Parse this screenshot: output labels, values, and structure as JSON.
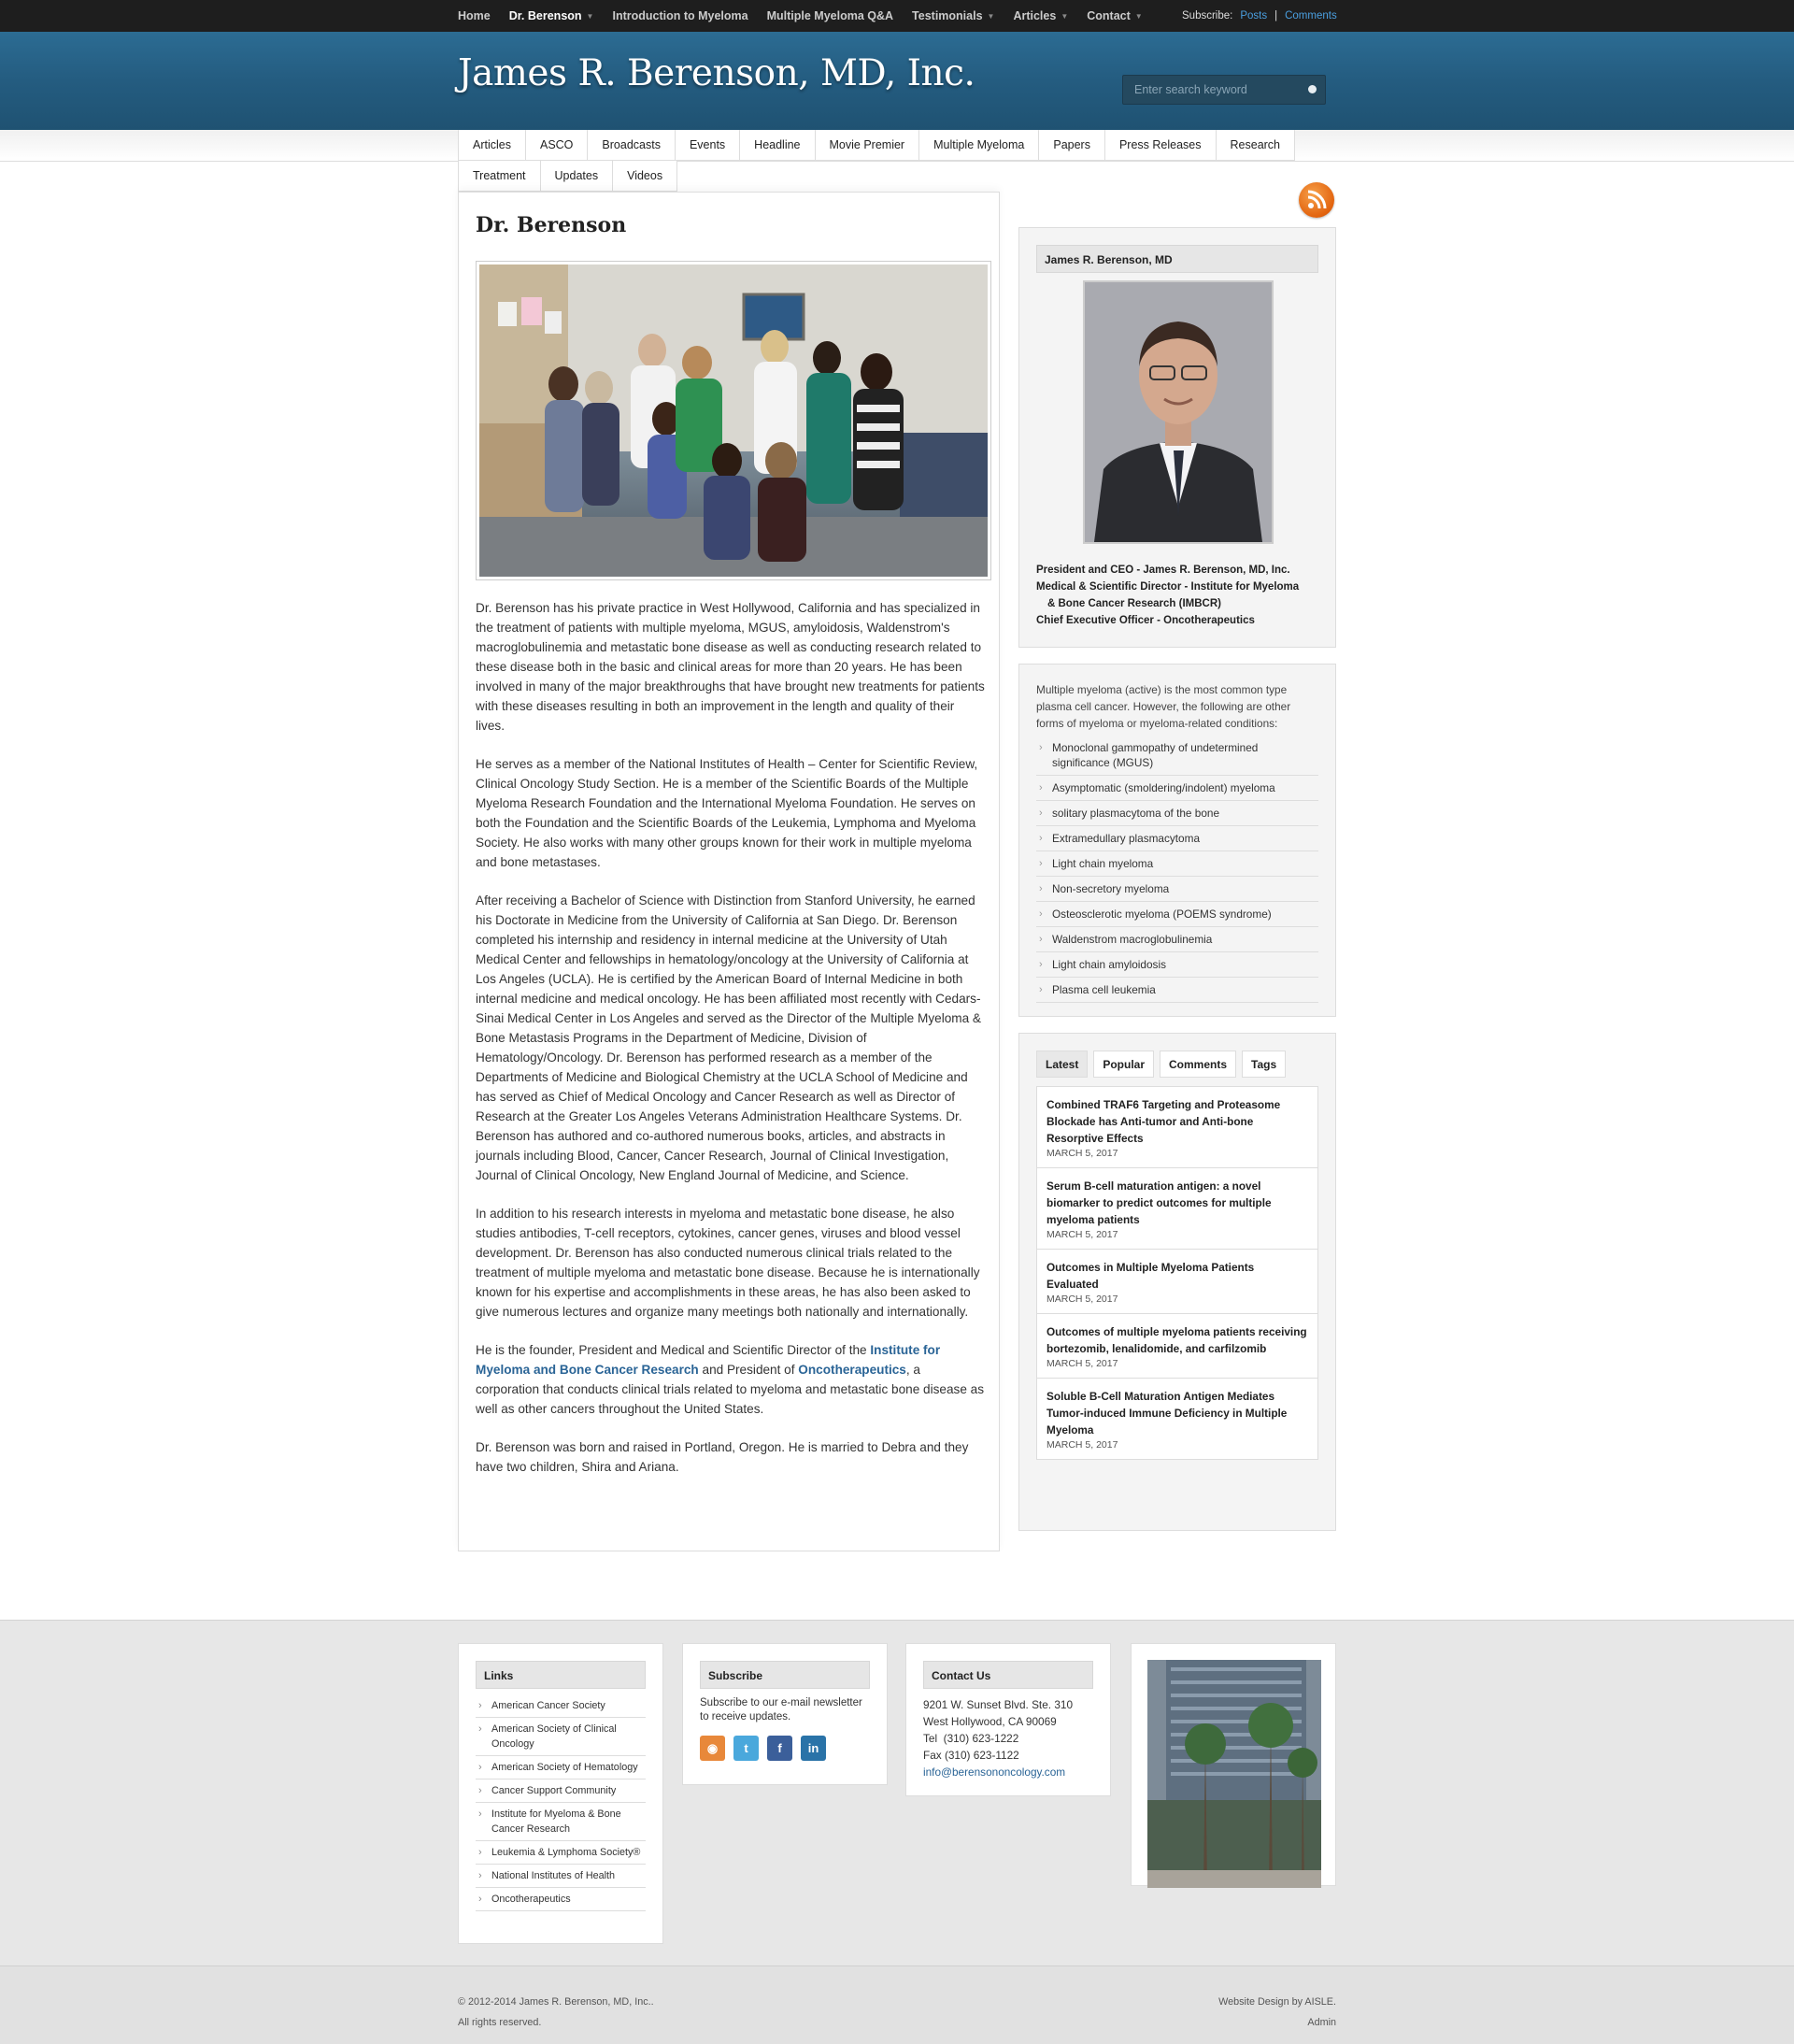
{
  "topnav": {
    "items": [
      {
        "label": "Home",
        "dropdown": false,
        "active": false
      },
      {
        "label": "Dr. Berenson",
        "dropdown": true,
        "active": true
      },
      {
        "label": "Introduction to Myeloma",
        "dropdown": false,
        "active": false
      },
      {
        "label": "Multiple Myeloma Q&A",
        "dropdown": false,
        "active": false
      },
      {
        "label": "Testimonials",
        "dropdown": true,
        "active": false
      },
      {
        "label": "Articles",
        "dropdown": true,
        "active": false
      },
      {
        "label": "Contact",
        "dropdown": true,
        "active": false
      }
    ],
    "subscribe_label": "Subscribe:",
    "posts_label": "Posts",
    "separator": "|",
    "comments_label": "Comments"
  },
  "header": {
    "title": "James R. Berenson, MD, Inc.",
    "search_placeholder": "Enter search keyword"
  },
  "catnav": {
    "items": [
      "Articles",
      "ASCO",
      "Broadcasts",
      "Events",
      "Headline",
      "Movie Premier",
      "Multiple Myeloma",
      "Papers",
      "Press Releases",
      "Research",
      "Treatment",
      "Updates",
      "Videos"
    ]
  },
  "main": {
    "title": "Dr. Berenson",
    "paragraphs": {
      "p1": "Dr. Berenson has his private practice in West Hollywood, California and has specialized in the treatment of patients with multiple myeloma, MGUS, amyloidosis, Waldenstrom's macroglobulinemia and metastatic bone disease as well as conducting research related to these disease both in the basic and clinical areas for more than 20 years. He has been involved in many of the major breakthroughs that have brought new treatments for patients with these diseases resulting in both an improvement in the length and quality of their lives.",
      "p2": "He serves as a member of the National Institutes of Health – Center for Scientific Review, Clinical Oncology Study Section. He is a member of the Scientific Boards of the Multiple Myeloma Research Foundation and the International Myeloma Foundation. He serves on both the Foundation and the Scientific Boards of the Leukemia, Lymphoma and Myeloma Society. He also works with many other groups known for their work in multiple myeloma and bone metastases.",
      "p3": "After receiving a Bachelor of Science with Distinction from Stanford University, he earned his Doctorate in Medicine from the University of California at San Diego. Dr. Berenson completed his internship and residency in internal medicine at the University of Utah Medical Center and fellowships in hematology/oncology at the University of California at Los Angeles (UCLA). He is certified by the American Board of Internal Medicine in both internal medicine and medical oncology. He has been affiliated most recently with Cedars-Sinai Medical Center in Los Angeles and served as the Director of the Multiple Myeloma & Bone Metastasis Programs in the Department of Medicine, Division of Hematology/Oncology. Dr. Berenson has performed research as a member of the Departments of Medicine and Biological Chemistry at the UCLA School of Medicine and has served as Chief of Medical Oncology and Cancer Research as well as Director of Research at the Greater Los Angeles Veterans Administration Healthcare Systems. Dr. Berenson has authored and co-authored numerous books, articles, and abstracts in journals including Blood, Cancer, Cancer Research, Journal of Clinical Investigation, Journal of Clinical Oncology, New England Journal of Medicine, and Science.",
      "p4": "In addition to his research interests in myeloma and metastatic bone disease, he also studies antibodies, T-cell receptors, cytokines, cancer genes, viruses and blood vessel development. Dr. Berenson has also conducted numerous clinical trials related to the treatment of multiple myeloma and metastatic bone disease. Because he is internationally known for his expertise and accomplishments in these areas, he has also been asked to give numerous lectures and organize many meetings both nationally and internationally.",
      "p5a": "He is the founder, President and Medical and Scientific Director of the ",
      "p5link1": "Institute for Myeloma and Bone Cancer Research",
      "p5b": " and President of ",
      "p5link2": "Oncotherapeutics",
      "p5c": ", a corporation that conducts clinical trials related to myeloma and metastatic bone disease as well as other cancers throughout the United States.",
      "p6": "Dr. Berenson was born and raised in Portland, Oregon. He is married to Debra and they have two children, Shira and Ariana."
    }
  },
  "sidebar": {
    "profile": {
      "heading": "James R. Berenson, MD",
      "roles": [
        "President and CEO - James R. Berenson, MD, Inc.",
        "Medical & Scientific Director - Institute for Myeloma",
        "& Bone Cancer Research (IMBCR)",
        "Chief Executive Officer - Oncotherapeutics"
      ]
    },
    "types": {
      "intro": "Multiple myeloma (active) is the most common type plasma cell cancer. However, the following are other forms of myeloma or myeloma-related conditions:",
      "items": [
        "Monoclonal gammopathy of undetermined significance (MGUS)",
        "Asymptomatic (smoldering/indolent) myeloma",
        "solitary plasmacytoma of the bone",
        "Extramedullary plasmacytoma",
        "Light chain myeloma",
        "Non-secretory myeloma",
        "Osteosclerotic myeloma (POEMS syndrome)",
        "Waldenstrom macroglobulinemia",
        "Light chain amyloidosis",
        "Plasma cell leukemia"
      ]
    },
    "tabs": [
      "Latest",
      "Popular",
      "Comments",
      "Tags"
    ],
    "posts": [
      {
        "title": "Combined TRAF6 Targeting and Proteasome Blockade has Anti-tumor and Anti-bone Resorptive Effects",
        "date": "MARCH 5, 2017"
      },
      {
        "title": "Serum B-cell maturation antigen: a novel biomarker to predict outcomes for multiple myeloma patients",
        "date": "MARCH 5, 2017"
      },
      {
        "title": "Outcomes in Multiple Myeloma Patients Evaluated",
        "date": "MARCH 5, 2017"
      },
      {
        "title": "Outcomes of multiple myeloma patients receiving bortezomib, lenalidomide, and carfilzomib",
        "date": "MARCH 5, 2017"
      },
      {
        "title": "Soluble B-Cell Maturation Antigen Mediates Tumor-induced Immune Deficiency in Multiple Myeloma",
        "date": "MARCH 5, 2017"
      }
    ]
  },
  "footer": {
    "links": {
      "heading": "Links",
      "items": [
        "American Cancer Society",
        "American Society of Clinical Oncology",
        "American Society of Hematology",
        "Cancer Support Community",
        "Institute for Myeloma & Bone Cancer Research",
        "Leukemia & Lymphoma Society®",
        "National Institutes of Health",
        "Oncotherapeutics"
      ]
    },
    "subscribe": {
      "heading": "Subscribe",
      "text": "Subscribe to our e-mail newsletter to receive updates.",
      "icons": [
        {
          "name": "rss-icon",
          "glyph": "◉",
          "color": "#e8883a"
        },
        {
          "name": "twitter-icon",
          "glyph": "t",
          "color": "#4aa8dc"
        },
        {
          "name": "facebook-icon",
          "glyph": "f",
          "color": "#3b5f9a"
        },
        {
          "name": "linkedin-icon",
          "glyph": "in",
          "color": "#2a73a8"
        }
      ]
    },
    "contact": {
      "heading": "Contact Us",
      "address1": "9201 W. Sunset Blvd. Ste. 310",
      "address2": "West Hollywood, CA 90069",
      "tel": "Tel  (310) 623-1222",
      "fax": "Fax (310) 623-1122",
      "email": "info@berensononcology.com"
    },
    "copyright": "© 2012-2014 James R. Berenson, MD, Inc..",
    "rights": "All rights reserved.",
    "credit": "Website Design by AISLE.",
    "admin": "Admin"
  },
  "colors": {
    "header_blue": "#245c80",
    "topbar": "#1e1e1e",
    "link_blue": "#2a6496",
    "subscribe_link": "#4a9fe0",
    "rss_orange": "#e2630e"
  }
}
